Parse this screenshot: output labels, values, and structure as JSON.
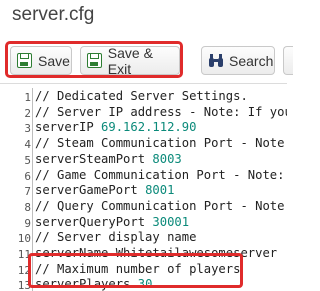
{
  "title": "server.cfg",
  "toolbar": {
    "save_label": "Save",
    "save_exit_label": "Save & Exit",
    "search_label": "Search"
  },
  "icons": {
    "save": "floppy-disk-icon",
    "save_exit": "floppy-disk-icon",
    "search": "binoculars-icon"
  },
  "colors": {
    "highlight": "#e02b2b",
    "save_icon": "#2e7d32",
    "number": "#0b8a7a"
  },
  "editor": {
    "lines": [
      {
        "n": "1",
        "text": "// Dedicated Server Settings.",
        "value": ""
      },
      {
        "n": "2",
        "text": "// Server IP address - Note: If you",
        "value": ""
      },
      {
        "n": "3",
        "text": "serverIP ",
        "value": "69.162.112.90"
      },
      {
        "n": "4",
        "text": "// Steam Communication Port - Note:",
        "value": ""
      },
      {
        "n": "5",
        "text": "serverSteamPort ",
        "value": "8003"
      },
      {
        "n": "6",
        "text": "// Game Communication Port - Note: ",
        "value": ""
      },
      {
        "n": "7",
        "text": "serverGamePort ",
        "value": "8001"
      },
      {
        "n": "8",
        "text": "// Query Communication Port - Note:",
        "value": ""
      },
      {
        "n": "9",
        "text": "serverQueryPort ",
        "value": "30001"
      },
      {
        "n": "10",
        "text": "// Server display name",
        "value": ""
      },
      {
        "n": "11",
        "text": "serverName Whitetailawesomeserver",
        "value": ""
      },
      {
        "n": "12",
        "text": "// Maximum number of players",
        "value": ""
      },
      {
        "n": "13",
        "text": "serverPlayers ",
        "value": "30"
      }
    ]
  }
}
